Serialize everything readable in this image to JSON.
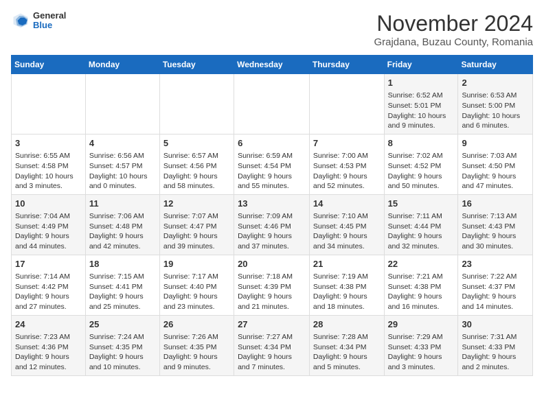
{
  "logo": {
    "general": "General",
    "blue": "Blue"
  },
  "title": "November 2024",
  "location": "Grajdana, Buzau County, Romania",
  "weekdays": [
    "Sunday",
    "Monday",
    "Tuesday",
    "Wednesday",
    "Thursday",
    "Friday",
    "Saturday"
  ],
  "rows": [
    [
      {
        "day": "",
        "content": ""
      },
      {
        "day": "",
        "content": ""
      },
      {
        "day": "",
        "content": ""
      },
      {
        "day": "",
        "content": ""
      },
      {
        "day": "",
        "content": ""
      },
      {
        "day": "1",
        "content": "Sunrise: 6:52 AM\nSunset: 5:01 PM\nDaylight: 10 hours and 9 minutes."
      },
      {
        "day": "2",
        "content": "Sunrise: 6:53 AM\nSunset: 5:00 PM\nDaylight: 10 hours and 6 minutes."
      }
    ],
    [
      {
        "day": "3",
        "content": "Sunrise: 6:55 AM\nSunset: 4:58 PM\nDaylight: 10 hours and 3 minutes."
      },
      {
        "day": "4",
        "content": "Sunrise: 6:56 AM\nSunset: 4:57 PM\nDaylight: 10 hours and 0 minutes."
      },
      {
        "day": "5",
        "content": "Sunrise: 6:57 AM\nSunset: 4:56 PM\nDaylight: 9 hours and 58 minutes."
      },
      {
        "day": "6",
        "content": "Sunrise: 6:59 AM\nSunset: 4:54 PM\nDaylight: 9 hours and 55 minutes."
      },
      {
        "day": "7",
        "content": "Sunrise: 7:00 AM\nSunset: 4:53 PM\nDaylight: 9 hours and 52 minutes."
      },
      {
        "day": "8",
        "content": "Sunrise: 7:02 AM\nSunset: 4:52 PM\nDaylight: 9 hours and 50 minutes."
      },
      {
        "day": "9",
        "content": "Sunrise: 7:03 AM\nSunset: 4:50 PM\nDaylight: 9 hours and 47 minutes."
      }
    ],
    [
      {
        "day": "10",
        "content": "Sunrise: 7:04 AM\nSunset: 4:49 PM\nDaylight: 9 hours and 44 minutes."
      },
      {
        "day": "11",
        "content": "Sunrise: 7:06 AM\nSunset: 4:48 PM\nDaylight: 9 hours and 42 minutes."
      },
      {
        "day": "12",
        "content": "Sunrise: 7:07 AM\nSunset: 4:47 PM\nDaylight: 9 hours and 39 minutes."
      },
      {
        "day": "13",
        "content": "Sunrise: 7:09 AM\nSunset: 4:46 PM\nDaylight: 9 hours and 37 minutes."
      },
      {
        "day": "14",
        "content": "Sunrise: 7:10 AM\nSunset: 4:45 PM\nDaylight: 9 hours and 34 minutes."
      },
      {
        "day": "15",
        "content": "Sunrise: 7:11 AM\nSunset: 4:44 PM\nDaylight: 9 hours and 32 minutes."
      },
      {
        "day": "16",
        "content": "Sunrise: 7:13 AM\nSunset: 4:43 PM\nDaylight: 9 hours and 30 minutes."
      }
    ],
    [
      {
        "day": "17",
        "content": "Sunrise: 7:14 AM\nSunset: 4:42 PM\nDaylight: 9 hours and 27 minutes."
      },
      {
        "day": "18",
        "content": "Sunrise: 7:15 AM\nSunset: 4:41 PM\nDaylight: 9 hours and 25 minutes."
      },
      {
        "day": "19",
        "content": "Sunrise: 7:17 AM\nSunset: 4:40 PM\nDaylight: 9 hours and 23 minutes."
      },
      {
        "day": "20",
        "content": "Sunrise: 7:18 AM\nSunset: 4:39 PM\nDaylight: 9 hours and 21 minutes."
      },
      {
        "day": "21",
        "content": "Sunrise: 7:19 AM\nSunset: 4:38 PM\nDaylight: 9 hours and 18 minutes."
      },
      {
        "day": "22",
        "content": "Sunrise: 7:21 AM\nSunset: 4:38 PM\nDaylight: 9 hours and 16 minutes."
      },
      {
        "day": "23",
        "content": "Sunrise: 7:22 AM\nSunset: 4:37 PM\nDaylight: 9 hours and 14 minutes."
      }
    ],
    [
      {
        "day": "24",
        "content": "Sunrise: 7:23 AM\nSunset: 4:36 PM\nDaylight: 9 hours and 12 minutes."
      },
      {
        "day": "25",
        "content": "Sunrise: 7:24 AM\nSunset: 4:35 PM\nDaylight: 9 hours and 10 minutes."
      },
      {
        "day": "26",
        "content": "Sunrise: 7:26 AM\nSunset: 4:35 PM\nDaylight: 9 hours and 9 minutes."
      },
      {
        "day": "27",
        "content": "Sunrise: 7:27 AM\nSunset: 4:34 PM\nDaylight: 9 hours and 7 minutes."
      },
      {
        "day": "28",
        "content": "Sunrise: 7:28 AM\nSunset: 4:34 PM\nDaylight: 9 hours and 5 minutes."
      },
      {
        "day": "29",
        "content": "Sunrise: 7:29 AM\nSunset: 4:33 PM\nDaylight: 9 hours and 3 minutes."
      },
      {
        "day": "30",
        "content": "Sunrise: 7:31 AM\nSunset: 4:33 PM\nDaylight: 9 hours and 2 minutes."
      }
    ]
  ]
}
